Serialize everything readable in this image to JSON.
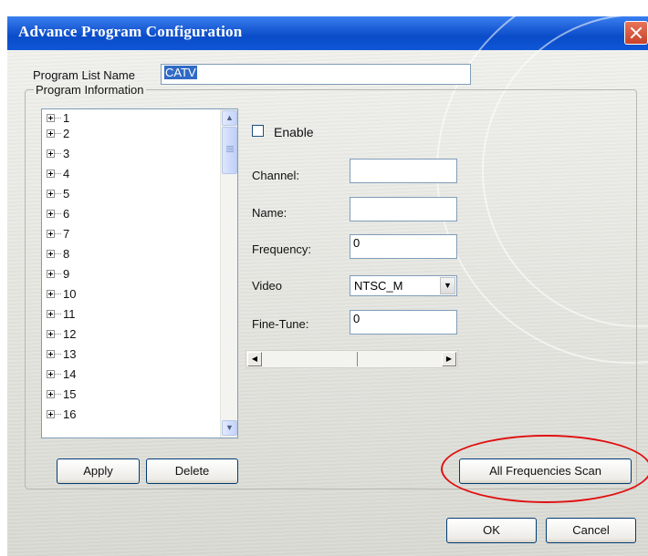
{
  "window": {
    "title": "Advance Program Configuration"
  },
  "program_list_name": {
    "label": "Program List Name",
    "value": "CATV"
  },
  "program_information": {
    "group_label": "Program Information",
    "items": [
      "1",
      "2",
      "3",
      "4",
      "5",
      "6",
      "7",
      "8",
      "9",
      "10",
      "11",
      "12",
      "13",
      "14",
      "15",
      "16"
    ],
    "apply_label": "Apply",
    "delete_label": "Delete"
  },
  "details": {
    "enable_label": "Enable",
    "enable_checked": false,
    "channel_label": "Channel:",
    "channel_value": "",
    "name_label": "Name:",
    "name_value": "",
    "frequency_label": "Frequency:",
    "frequency_value": "0",
    "video_label": "Video",
    "video_value": "NTSC_M",
    "finetune_label": "Fine-Tune:",
    "finetune_value": "0"
  },
  "buttons": {
    "scan_label": "All Frequencies Scan",
    "ok_label": "OK",
    "cancel_label": "Cancel"
  },
  "icons": {
    "close": "close-icon",
    "expand": "plus-box-icon",
    "scroll_up": "chevron-up-icon",
    "scroll_down": "chevron-down-icon",
    "scroll_left": "arrow-left-icon",
    "scroll_right": "arrow-right-icon",
    "dropdown": "dropdown-arrow-icon"
  },
  "colors": {
    "titlebar": "#0a4cc8",
    "highlight_circle": "#e01010",
    "selection": "#316ac5"
  }
}
